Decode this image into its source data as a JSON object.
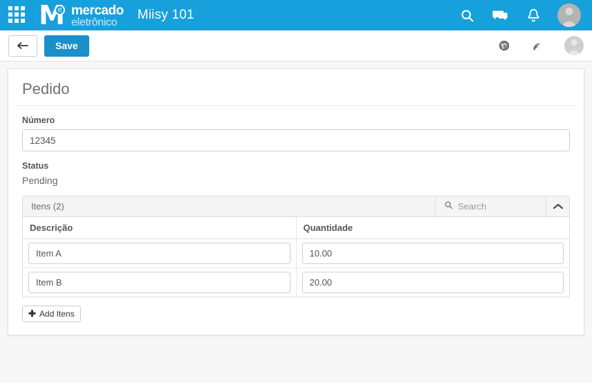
{
  "topbar": {
    "apps_icon": "apps-grid-icon",
    "logo": {
      "mark_letter": "M",
      "mark_superscript": "e",
      "line1": "mercado",
      "line2": "eletrônico"
    },
    "app_title": "Miisy 101",
    "icons": [
      {
        "name": "search-icon",
        "label": "Search"
      },
      {
        "name": "chat-icon",
        "label": "Messages"
      },
      {
        "name": "bell-icon",
        "label": "Notifications"
      }
    ],
    "avatar": "user-avatar",
    "background_color": "#17a0dc"
  },
  "actionbar": {
    "back_label": "←",
    "save_label": "Save",
    "save_color": "#1a8fc8",
    "icons": [
      {
        "name": "globe-icon",
        "label": "Language"
      },
      {
        "name": "rss-icon",
        "label": "Feed"
      }
    ],
    "avatar": "user-avatar"
  },
  "card": {
    "title": "Pedido",
    "fields": {
      "numero": {
        "label": "Número",
        "value": "12345",
        "placeholder": "Número"
      },
      "status": {
        "label": "Status",
        "value": "Pending"
      }
    },
    "panel": {
      "title": "Itens (2)",
      "search_placeholder": "Search",
      "search_value": "",
      "collapse_icon": "chevron-up-icon",
      "columns": [
        "Descrição",
        "Quantidade"
      ],
      "rows": [
        {
          "descricao": "Item A",
          "quantidade": "10.00"
        },
        {
          "descricao": "Item B",
          "quantidade": "20.00"
        }
      ]
    },
    "add_button": {
      "icon": "plus-icon",
      "label": "Add Itens"
    }
  }
}
